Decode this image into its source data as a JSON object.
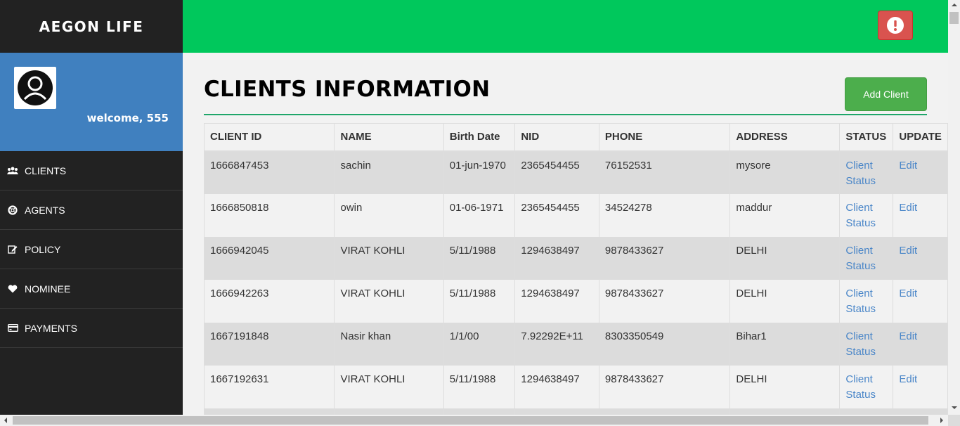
{
  "brand": "AEGON LIFE",
  "profile": {
    "welcome": "welcome, 555"
  },
  "nav": [
    {
      "label": "CLIENTS",
      "icon": "users-icon"
    },
    {
      "label": "AGENTS",
      "icon": "life-ring-icon"
    },
    {
      "label": "POLICY",
      "icon": "edit-icon"
    },
    {
      "label": "NOMINEE",
      "icon": "heart-icon"
    },
    {
      "label": "PAYMENTS",
      "icon": "credit-card-icon"
    }
  ],
  "header": {
    "alert_icon": "exclamation-circle-icon"
  },
  "main": {
    "title": "CLIENTS INFORMATION",
    "add_button": "Add Client"
  },
  "table": {
    "headers": [
      "CLIENT ID",
      "NAME",
      "Birth Date",
      "NID",
      "PHONE",
      "ADDRESS",
      "STATUS",
      "UPDATE"
    ],
    "rows": [
      {
        "id": "1666847453",
        "name": "sachin",
        "birth": "01-jun-1970",
        "nid": "2365454455",
        "phone": "76152531",
        "address": "mysore",
        "status": "Client Status",
        "update": "Edit"
      },
      {
        "id": "1666850818",
        "name": "owin",
        "birth": "01-06-1971",
        "nid": "2365454455",
        "phone": "34524278",
        "address": "maddur",
        "status": "Client Status",
        "update": "Edit"
      },
      {
        "id": "1666942045",
        "name": "VIRAT KOHLI",
        "birth": "5/11/1988",
        "nid": "1294638497",
        "phone": "9878433627",
        "address": "DELHI",
        "status": "Client Status",
        "update": "Edit"
      },
      {
        "id": "1666942263",
        "name": "VIRAT KOHLI",
        "birth": "5/11/1988",
        "nid": "1294638497",
        "phone": "9878433627",
        "address": "DELHI",
        "status": "Client Status",
        "update": "Edit"
      },
      {
        "id": "1667191848",
        "name": "Nasir khan",
        "birth": "1/1/00",
        "nid": "7.92292E+11",
        "phone": "8303350549",
        "address": "Bihar1",
        "status": "Client Status",
        "update": "Edit"
      },
      {
        "id": "1667192631",
        "name": "VIRAT KOHLI",
        "birth": "5/11/1988",
        "nid": "1294638497",
        "phone": "9878433627",
        "address": "DELHI",
        "status": "Client Status",
        "update": "Edit"
      }
    ]
  },
  "colors": {
    "header_green": "#00c85c",
    "sidebar_dark": "#222222",
    "profile_blue": "#4080bf",
    "add_button_green": "#4cae4c",
    "alert_red": "#d9534f",
    "link_blue": "#4a86c8"
  }
}
